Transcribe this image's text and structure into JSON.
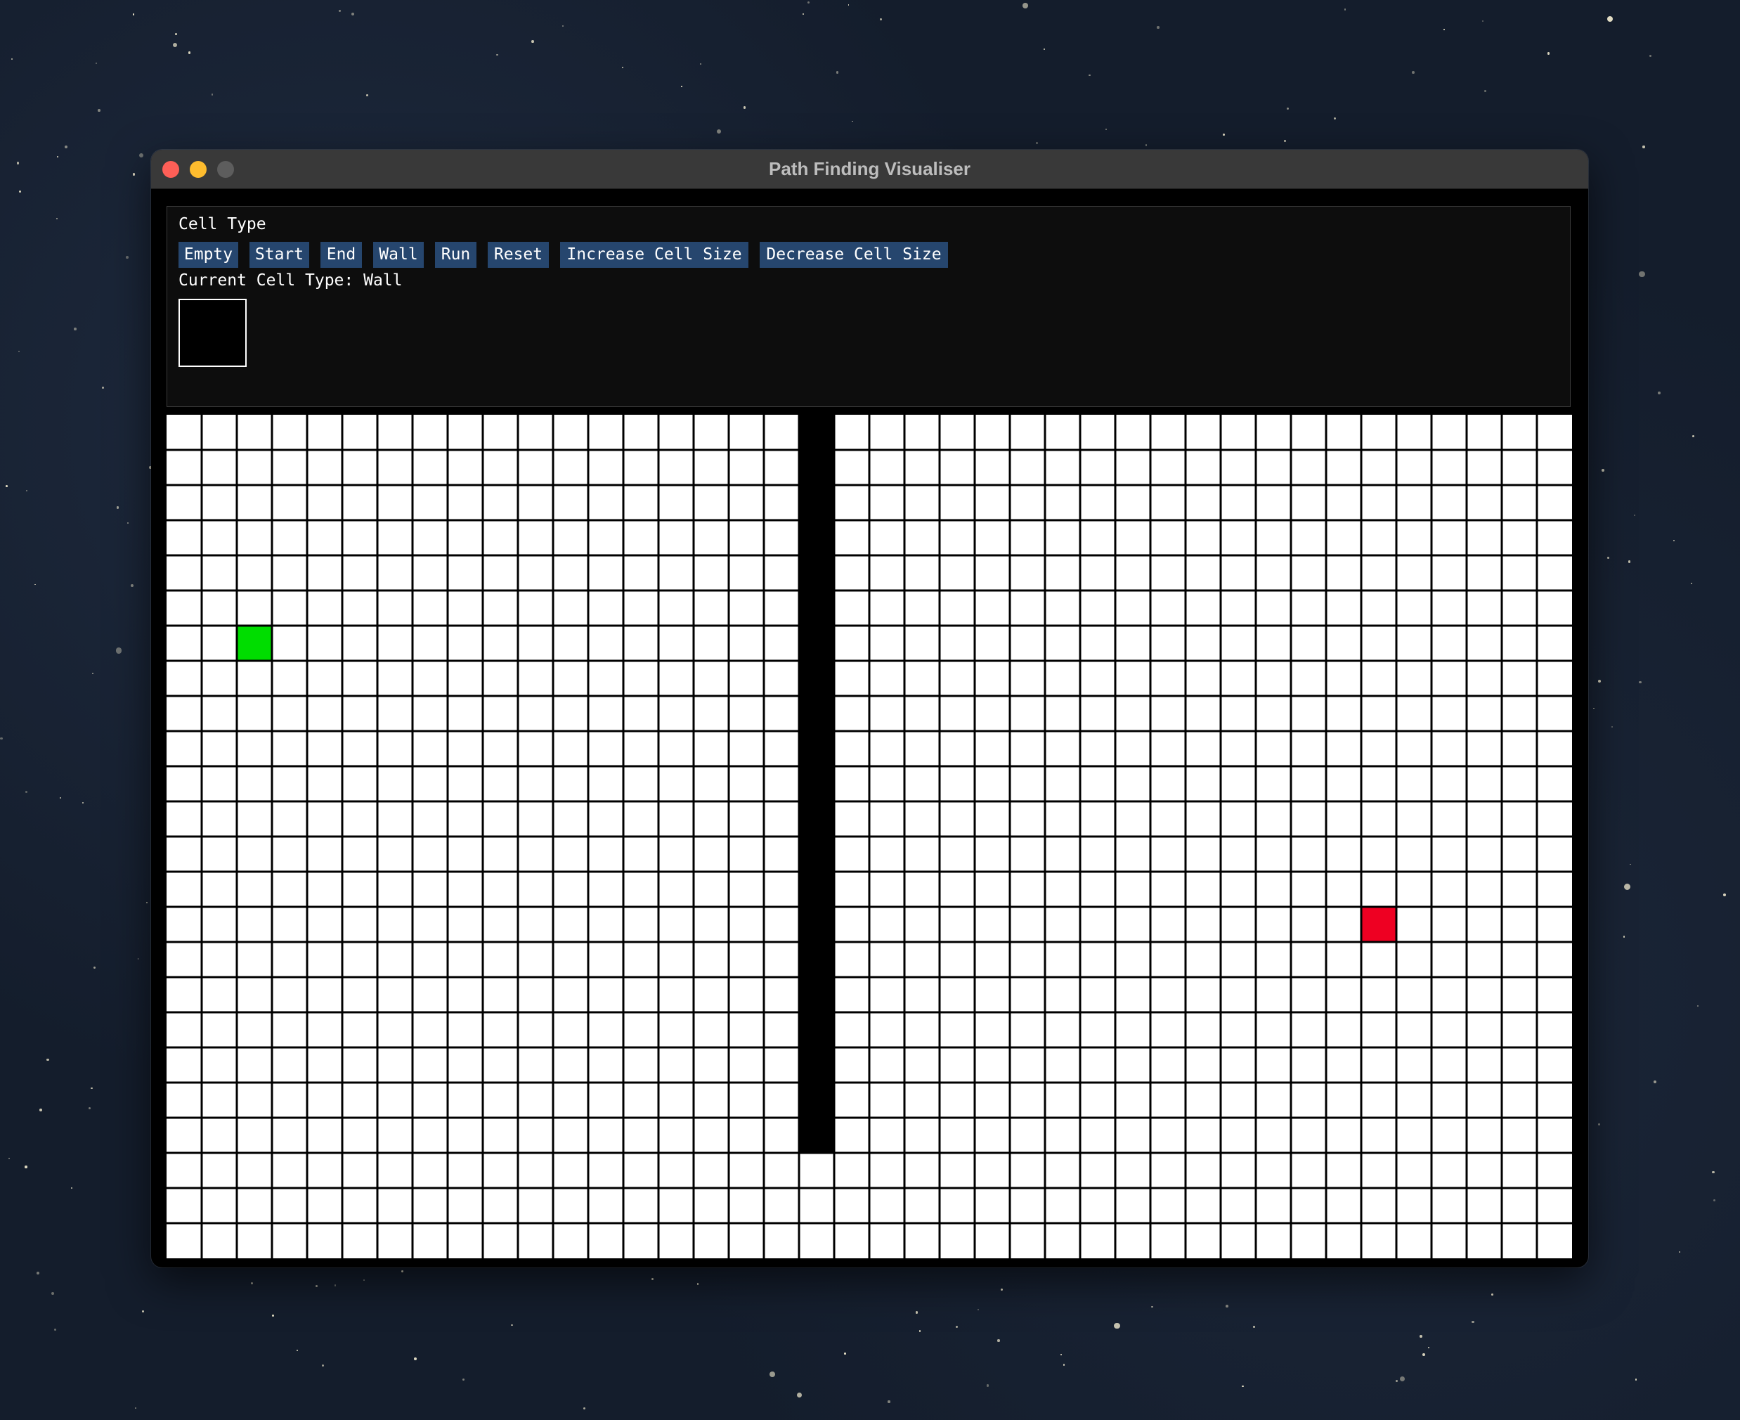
{
  "window": {
    "title": "Path Finding Visualiser"
  },
  "panel": {
    "heading": "Cell Type",
    "buttons": [
      {
        "label": "Empty"
      },
      {
        "label": "Start"
      },
      {
        "label": "End"
      },
      {
        "label": "Wall"
      },
      {
        "label": "Run"
      },
      {
        "label": "Reset"
      },
      {
        "label": "Increase Cell Size"
      },
      {
        "label": "Decrease Cell Size"
      }
    ],
    "current_cell_type_label": "Current Cell Type: Wall",
    "current_cell_type": "Wall"
  },
  "grid": {
    "columns": 40,
    "rows": 24,
    "start_cell": {
      "col": 2,
      "row": 6
    },
    "end_cell": {
      "col": 34,
      "row": 14
    },
    "wall_cells": [
      {
        "col": 18,
        "row": 0
      },
      {
        "col": 18,
        "row": 1
      },
      {
        "col": 18,
        "row": 2
      },
      {
        "col": 18,
        "row": 3
      },
      {
        "col": 18,
        "row": 4
      },
      {
        "col": 18,
        "row": 5
      },
      {
        "col": 18,
        "row": 6
      },
      {
        "col": 18,
        "row": 7
      },
      {
        "col": 18,
        "row": 8
      },
      {
        "col": 18,
        "row": 9
      },
      {
        "col": 18,
        "row": 10
      },
      {
        "col": 18,
        "row": 11
      },
      {
        "col": 18,
        "row": 12
      },
      {
        "col": 18,
        "row": 13
      },
      {
        "col": 18,
        "row": 14
      },
      {
        "col": 18,
        "row": 15
      },
      {
        "col": 18,
        "row": 16
      },
      {
        "col": 18,
        "row": 17
      },
      {
        "col": 18,
        "row": 18
      },
      {
        "col": 18,
        "row": 19
      },
      {
        "col": 18,
        "row": 20
      }
    ]
  },
  "colors": {
    "empty": "#ffffff",
    "start": "#00dd00",
    "end": "#ee0022",
    "wall": "#000000",
    "grid_line": "#000000",
    "button_bg": "#26466e"
  }
}
